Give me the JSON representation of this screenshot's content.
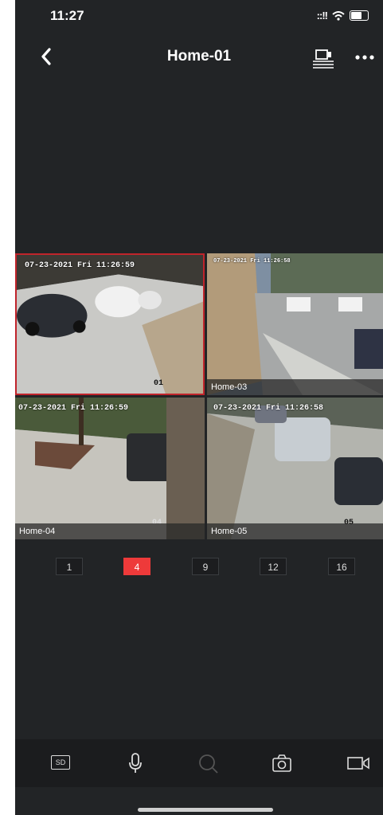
{
  "status": {
    "time": "11:27",
    "signal": "::!!"
  },
  "header": {
    "title": "Home-01"
  },
  "cameras": [
    {
      "osd": "07-23-2021 Fri 11:26:59",
      "number": "01",
      "label": ""
    },
    {
      "osd": "07-23-2021 Fri 11:26:58",
      "number": "",
      "label": "Home-03"
    },
    {
      "osd": "07-23-2021 Fri 11:26:59",
      "number": "04",
      "label": "Home-04"
    },
    {
      "osd": "07-23-2021 Fri 11:26:58",
      "number": "05",
      "label": "Home-05"
    }
  ],
  "pager": {
    "options": [
      "1",
      "4",
      "9",
      "12",
      "16"
    ],
    "selected": "4"
  },
  "toolbar": {
    "sd_label": "SD"
  },
  "colors": {
    "accent": "#ee3a3a",
    "selected_border": "#c0242b",
    "background": "#222426"
  },
  "icons": [
    "back-icon",
    "cast-icon",
    "more-icon",
    "sd-icon",
    "microphone-icon",
    "search-icon",
    "camera-icon",
    "record-icon"
  ]
}
